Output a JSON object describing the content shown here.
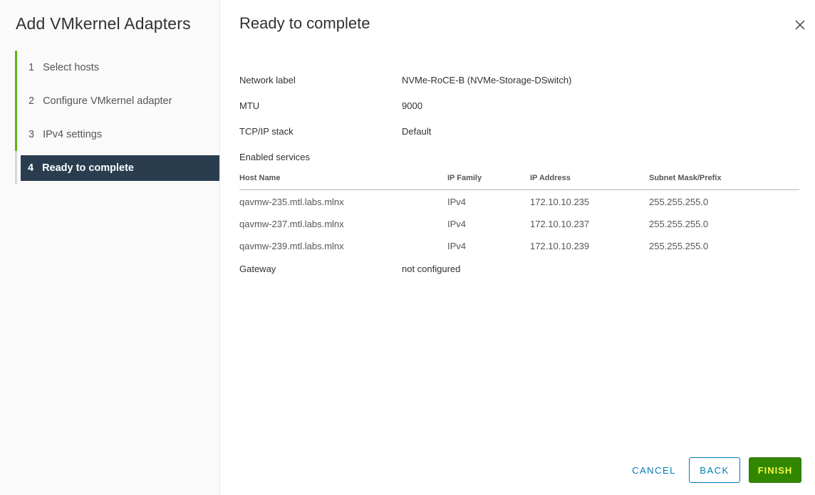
{
  "wizard": {
    "title": "Add VMkernel Adapters",
    "steps": [
      {
        "num": "1",
        "label": "Select hosts"
      },
      {
        "num": "2",
        "label": "Configure VMkernel adapter"
      },
      {
        "num": "3",
        "label": "IPv4 settings"
      },
      {
        "num": "4",
        "label": "Ready to complete"
      }
    ]
  },
  "page": {
    "title": "Ready to complete",
    "close_icon": "close-icon"
  },
  "summary": {
    "network_label": {
      "label": "Network label",
      "value": "NVMe-RoCE-B (NVMe-Storage-DSwitch)"
    },
    "mtu": {
      "label": "MTU",
      "value": "9000"
    },
    "tcpip_stack": {
      "label": "TCP/IP stack",
      "value": "Default"
    },
    "enabled_services": {
      "label": "Enabled services",
      "value": ""
    },
    "gateway": {
      "label": "Gateway",
      "value": "not configured"
    }
  },
  "hosts_table": {
    "columns": [
      "Host Name",
      "IP Family",
      "IP Address",
      "Subnet Mask/Prefix"
    ],
    "rows": [
      [
        "qavmw-235.mtl.labs.mlnx",
        "IPv4",
        "172.10.10.235",
        "255.255.255.0"
      ],
      [
        "qavmw-237.mtl.labs.mlnx",
        "IPv4",
        "172.10.10.237",
        "255.255.255.0"
      ],
      [
        "qavmw-239.mtl.labs.mlnx",
        "IPv4",
        "172.10.10.239",
        "255.255.255.0"
      ]
    ]
  },
  "buttons": {
    "cancel": "CANCEL",
    "back": "BACK",
    "finish": "FINISH"
  },
  "colors": {
    "accent": "#0079b8",
    "step_complete": "#60b515",
    "active_step_bg": "#2a3d4f",
    "finish_bg": "#318700"
  }
}
